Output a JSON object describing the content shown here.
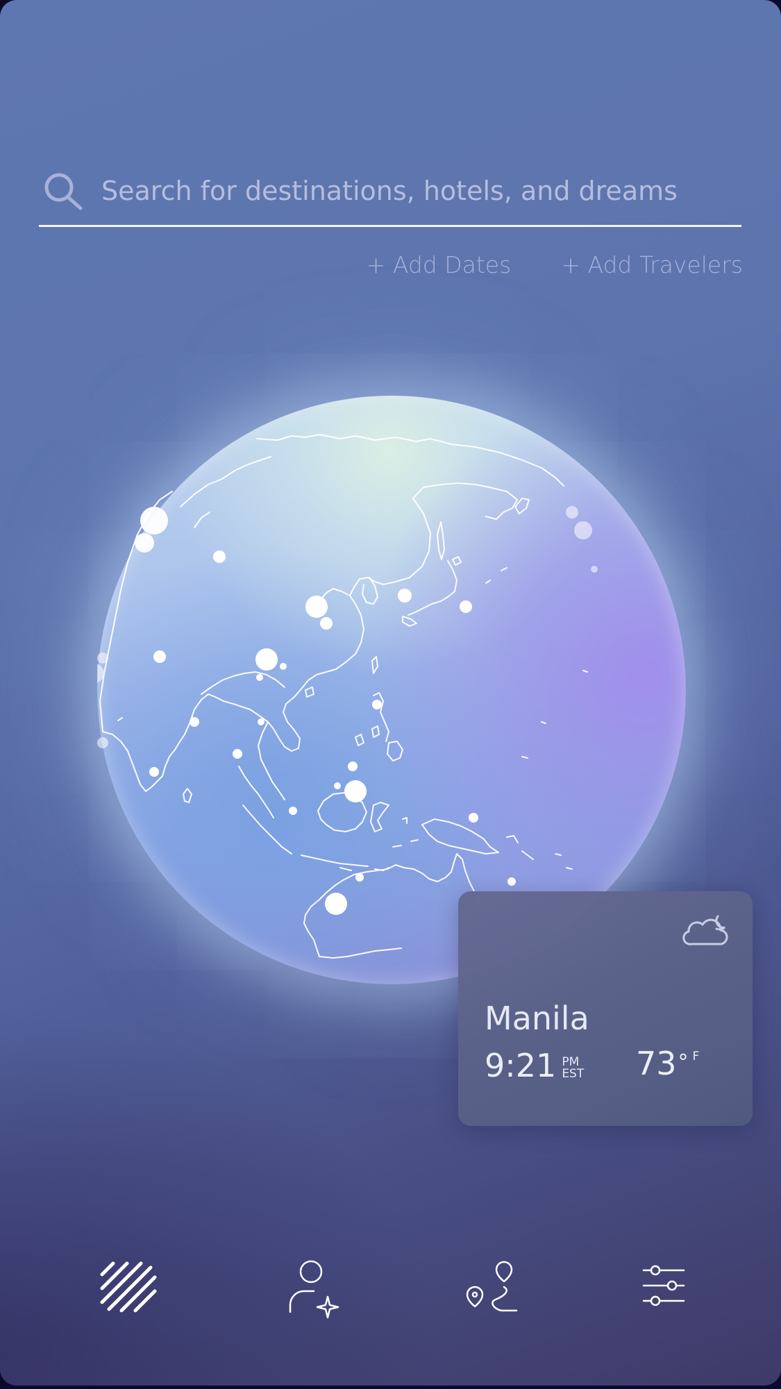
{
  "search": {
    "placeholder": "Search for destinations, hotels, and dreams",
    "icon": "search-icon"
  },
  "actions": {
    "add_dates": "+ Add Dates",
    "add_travelers": "+ Add Travelers"
  },
  "globe": {
    "region": "Asia-Pacific",
    "icon": "globe"
  },
  "weather": {
    "city": "Manila",
    "time": "9:21",
    "meridiem": "PM",
    "timezone": "EST",
    "temperature": "73",
    "degree_symbol": "°",
    "unit": "F",
    "icon": "partly-cloudy-night-icon"
  },
  "nav": {
    "items": [
      {
        "icon": "explore-stripes-icon",
        "active": true
      },
      {
        "icon": "profile-sparkle-icon",
        "active": false
      },
      {
        "icon": "route-map-icon",
        "active": false
      },
      {
        "icon": "settings-sliders-icon",
        "active": false
      }
    ]
  },
  "colors": {
    "background_top": "#5f77b0",
    "background_bottom": "#3e3a68",
    "card_background": "#5c6690",
    "text_light": "#e7e9f4",
    "text_muted": "#a6b1da"
  }
}
